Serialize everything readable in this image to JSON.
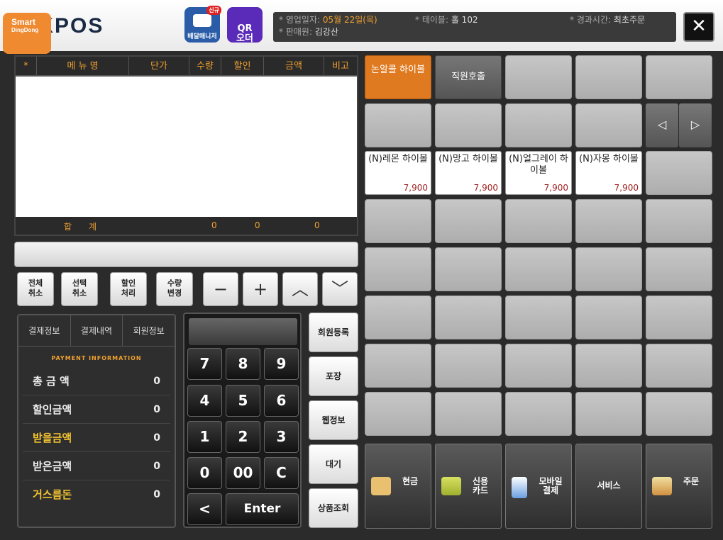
{
  "header": {
    "badge_title": "Smart",
    "badge_sub": "DingDong",
    "logo": "OKPOS",
    "delivery_label": "배달매니저",
    "delivery_tag": "신규",
    "qr_label": "QR\n오더",
    "business_date_label": "영업일자:",
    "business_date": "05월 22일(목)",
    "table_label": "테이블:",
    "table": "홀 102",
    "elapsed_label": "경과시간:",
    "elapsed": "최초주문",
    "cashier_label": "판매원:",
    "cashier": "김강산",
    "close": "✕"
  },
  "order_table": {
    "columns": [
      "*",
      "메 뉴 명",
      "단가",
      "수량",
      "할인",
      "금액",
      "비고"
    ],
    "total_label": "합　　계",
    "total_qty": "0",
    "total_discount": "0",
    "total_amount": "0"
  },
  "controls": {
    "cancel_all": "전체\n취소",
    "cancel_selected": "선택\n취소",
    "discount": "할인\n처리",
    "qty_change": "수량\n변경",
    "minus": "−",
    "plus": "+",
    "up": "︿",
    "down": "﹀"
  },
  "payment": {
    "tabs": [
      "결제정보",
      "결제내역",
      "회원정보"
    ],
    "heading": "PAYMENT INFORMATION",
    "rows": [
      {
        "label": "총 금 액",
        "value": "0"
      },
      {
        "label": "할인금액",
        "value": "0"
      },
      {
        "label": "받을금액",
        "value": "0"
      },
      {
        "label": "받은금액",
        "value": "0"
      },
      {
        "label": "거스름돈",
        "value": "0"
      }
    ]
  },
  "keypad": {
    "keys": [
      "7",
      "8",
      "9",
      "4",
      "5",
      "6",
      "1",
      "2",
      "3",
      "0",
      "00",
      "C",
      "<",
      "Enter"
    ]
  },
  "side_buttons": [
    "회원등록",
    "포장",
    "웹정보",
    "대기",
    "상품조회"
  ],
  "categories": {
    "active": "논알콜 하이볼",
    "staff_call": "직원호출",
    "active_color": "#e07a20"
  },
  "nav": {
    "prev": "◁",
    "next": "▷"
  },
  "menu_items": [
    {
      "name": "(N)레몬 하이볼",
      "price": "7,900"
    },
    {
      "name": "(N)망고 하이볼",
      "price": "7,900"
    },
    {
      "name": "(N)얼그레이 하이볼",
      "price": "7,900"
    },
    {
      "name": "(N)자몽 하이볼",
      "price": "7,900"
    }
  ],
  "pay_buttons": [
    {
      "label": "현금",
      "icon": "cash-icon"
    },
    {
      "label": "신용\n카드",
      "icon": "credit-card-icon"
    },
    {
      "label": "모바일\n결제",
      "icon": "mobile-pay-icon"
    },
    {
      "label": "서비스",
      "icon": ""
    },
    {
      "label": "주문",
      "icon": "order-icon"
    }
  ]
}
